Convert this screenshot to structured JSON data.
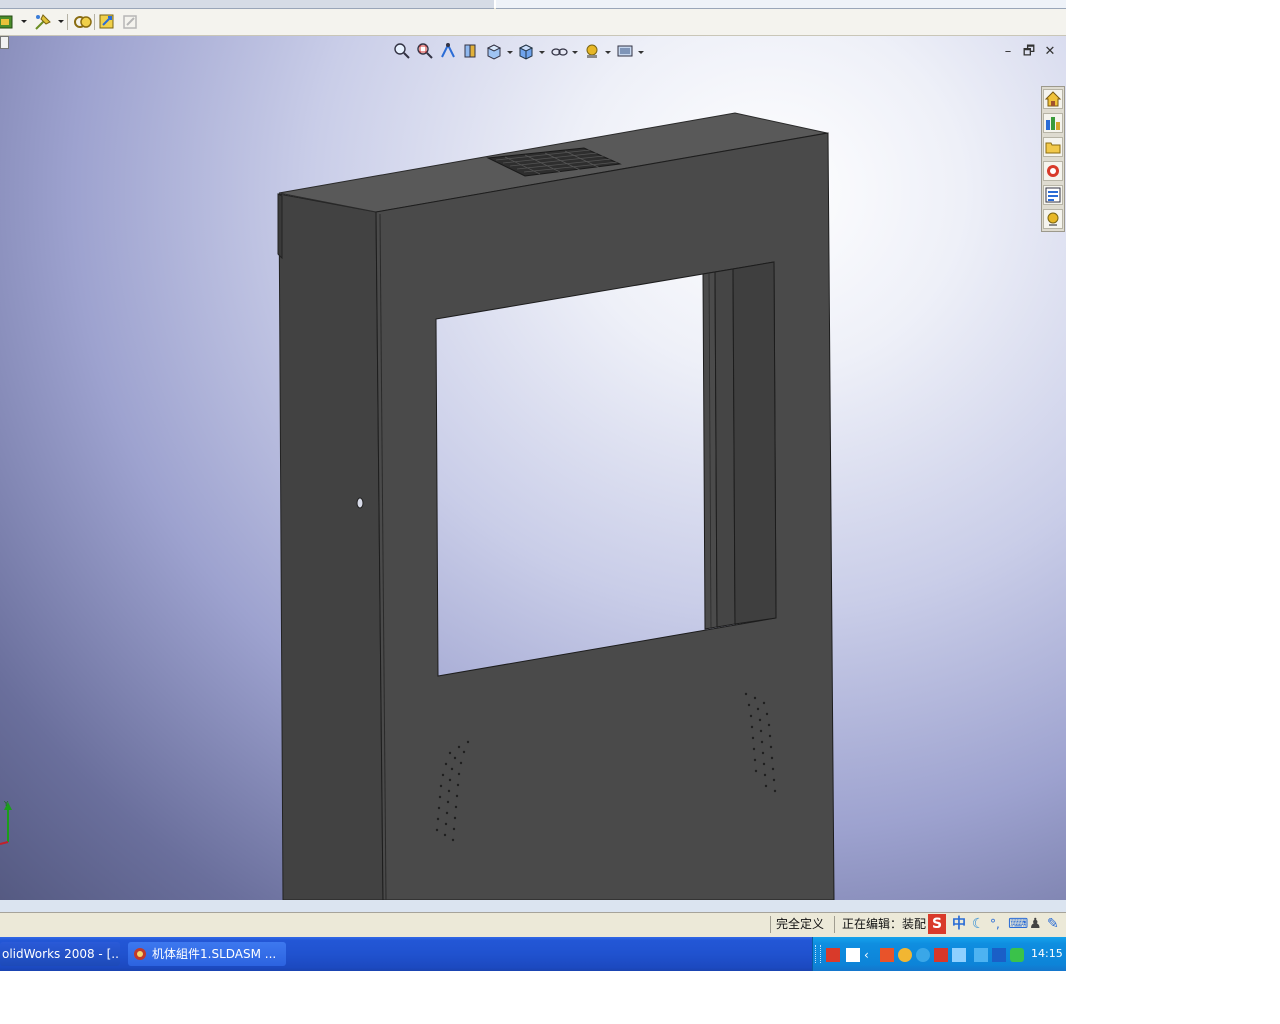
{
  "window": {
    "controls": {
      "minimize": "–",
      "restore": "🗗",
      "close": "✕"
    }
  },
  "toolbar": {
    "icons": [
      "assembly-icon",
      "smart-mate-icon",
      "rebuild-icon",
      "options-icon",
      "disabled-options-icon"
    ]
  },
  "heads_up": {
    "icons": [
      "zoom-to-fit-icon",
      "zoom-area-icon",
      "previous-view-icon",
      "section-view-icon",
      "view-orientation-icon",
      "display-style-icon",
      "hide-show-icon",
      "appearance-icon",
      "scene-icon"
    ]
  },
  "task_pane": {
    "icons": [
      "home-icon",
      "design-library-icon",
      "file-explorer-icon",
      "view-palette-icon",
      "appearances-icon",
      "custom-properties-icon"
    ]
  },
  "status": {
    "definition": "完全定义",
    "editing": "正在编辑：装配",
    "ime_mode": "中",
    "ime_punct": "°,"
  },
  "taskbar": {
    "items": [
      {
        "label": "olidWorks 2008 - [..."
      },
      {
        "label": "机体組件1.SLDASM ..."
      }
    ],
    "clock": "14:15"
  },
  "colors": {
    "model_front": "#4a4a4a",
    "model_side": "#424242",
    "model_top": "#595959",
    "taskbar": "#245edb",
    "tray": "#0f8ee0"
  }
}
